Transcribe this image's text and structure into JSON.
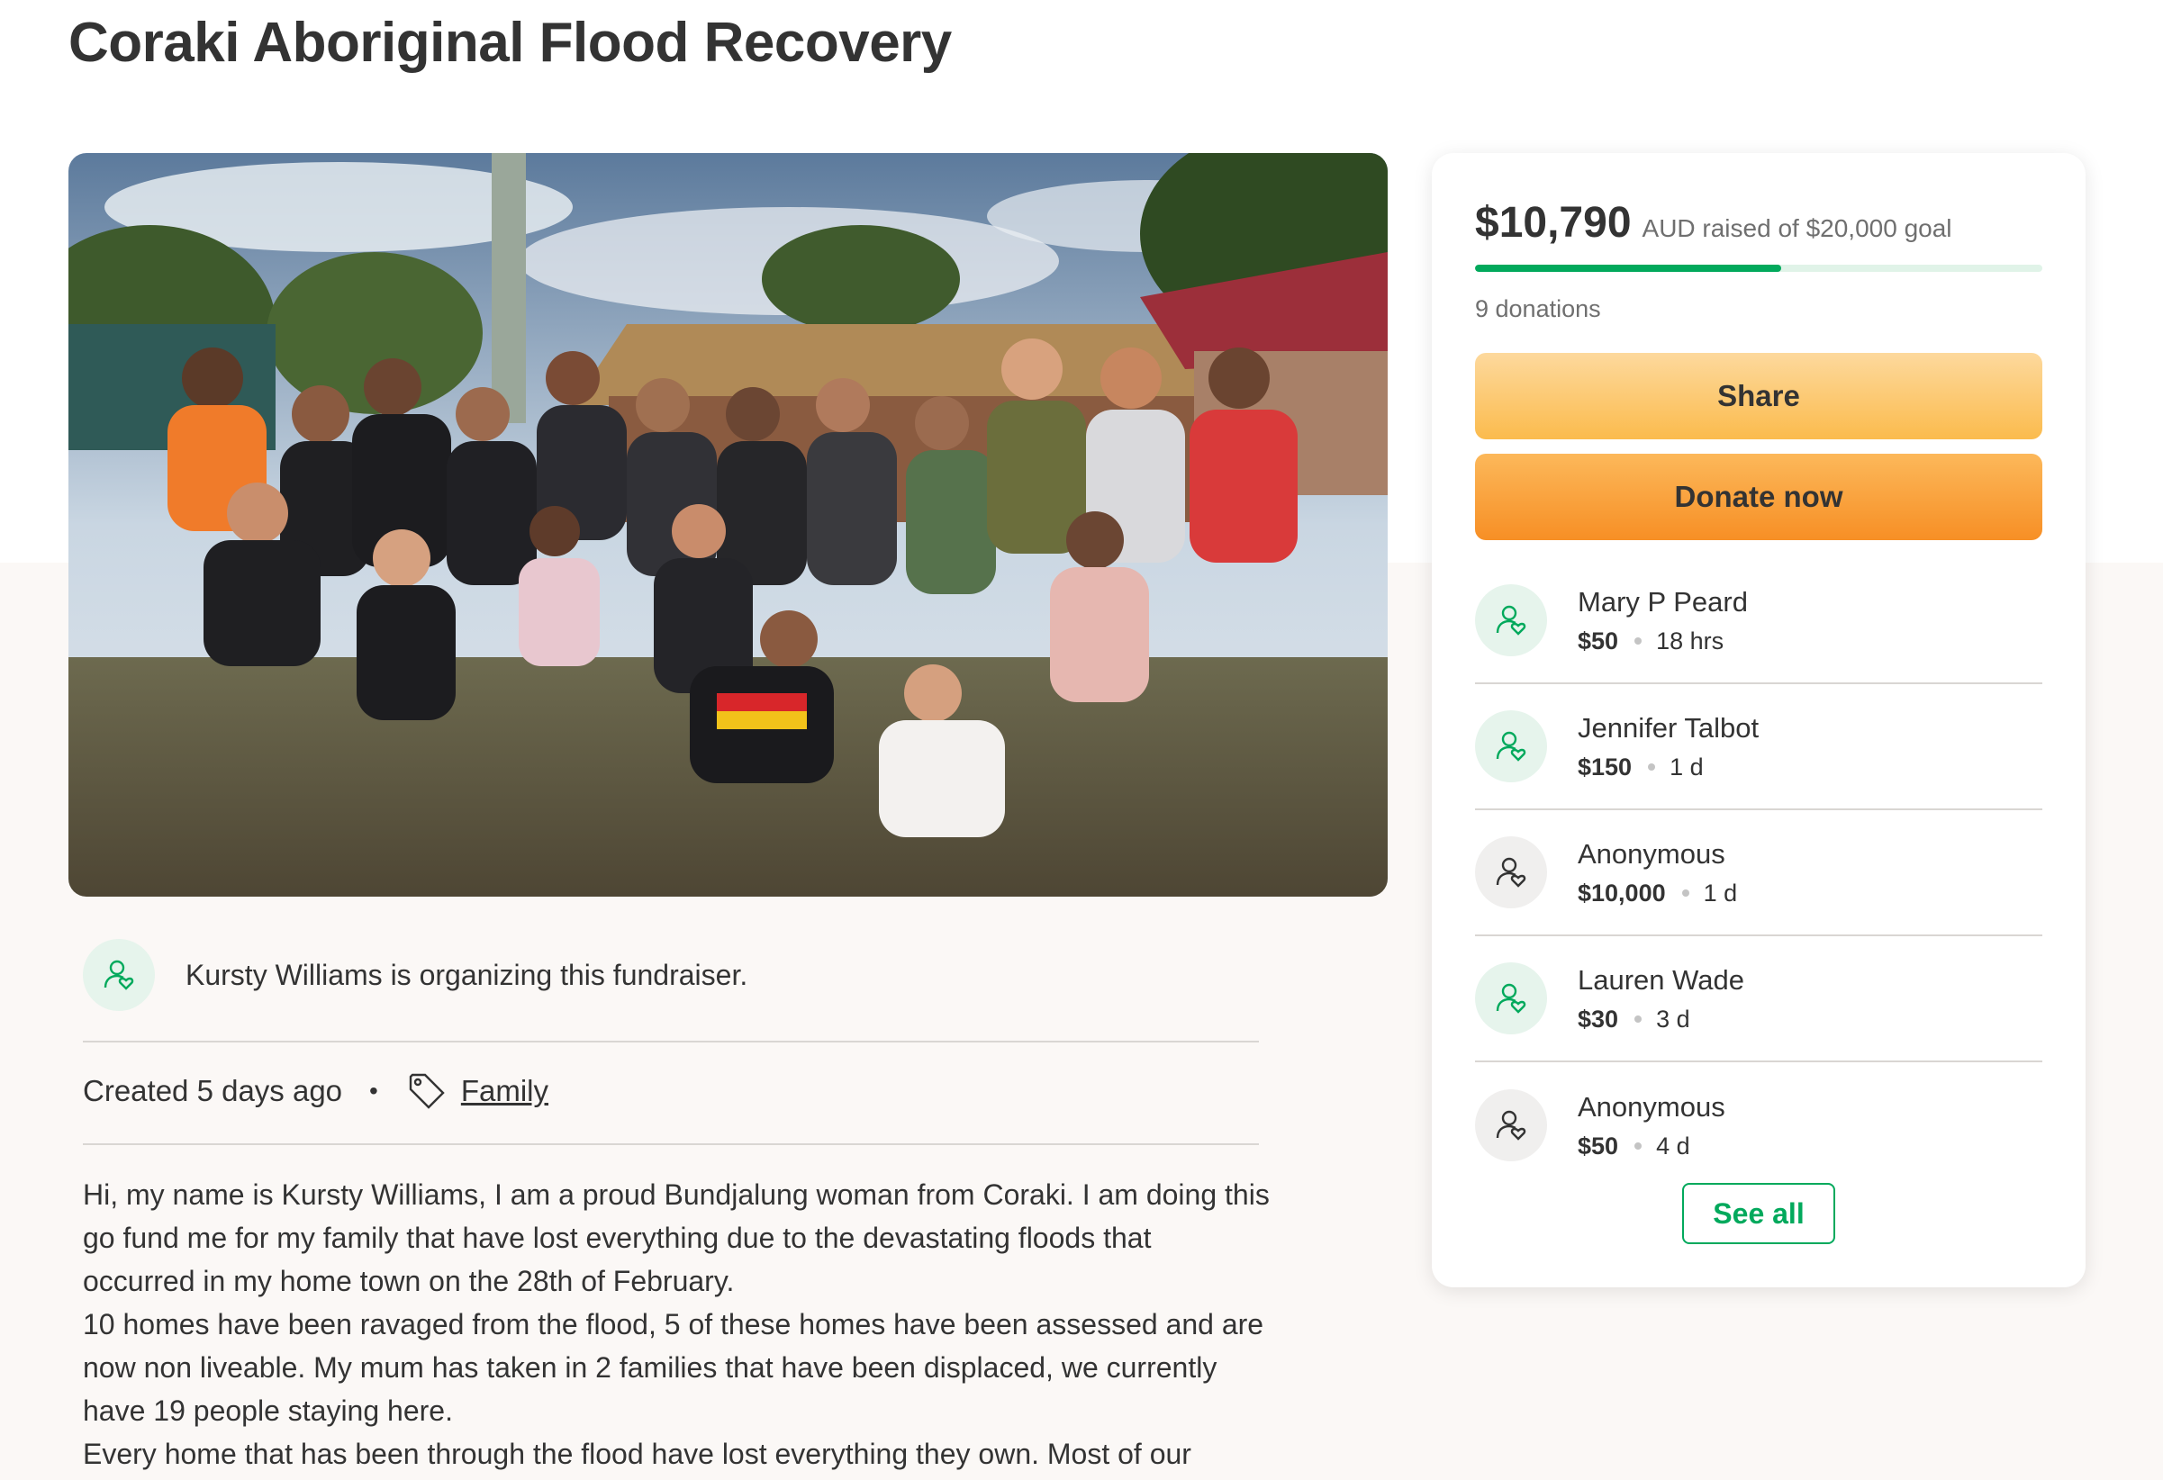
{
  "page": {
    "title": "Coraki Aboriginal Flood Recovery"
  },
  "organizer": {
    "text": "Kursty Williams is organizing this fundraiser."
  },
  "meta": {
    "created": "Created 5 days ago",
    "separator": "•",
    "category": "Family"
  },
  "story": {
    "lines": [
      "Hi, my name is Kursty Williams, I am a proud Bundjalung woman from Coraki. I am doing this",
      "go fund me for my family  that have lost everything due to the devastating floods that",
      "occurred in my home town on the 28th of February.",
      "10 homes have been ravaged from the flood, 5 of these homes have been assessed and are",
      "now non liveable. My mum has taken in 2 families that have been displaced, we currently",
      "have 19 people staying here.",
      "Every home that has been through the flood have lost everything they own. Most of our"
    ]
  },
  "donation_card": {
    "amount": "$10,790",
    "raised_text": "AUD raised of $20,000 goal",
    "progress": 0.54,
    "donations_count": "9 donations",
    "share_label": "Share",
    "donate_label": "Donate now",
    "see_all_label": "See all",
    "donors": [
      {
        "name": "Mary P Peard",
        "amount": "$50",
        "time": "18 hrs",
        "avatar": "green"
      },
      {
        "name": "Jennifer Talbot",
        "amount": "$150",
        "time": "1 d",
        "avatar": "green"
      },
      {
        "name": "Anonymous",
        "amount": "$10,000",
        "time": "1 d",
        "avatar": "grey"
      },
      {
        "name": "Lauren Wade",
        "amount": "$30",
        "time": "3 d",
        "avatar": "green"
      },
      {
        "name": "Anonymous",
        "amount": "$50",
        "time": "4 d",
        "avatar": "grey"
      }
    ]
  },
  "colors": {
    "accent": "#02a95c",
    "share_button": "#fbc76b",
    "donate_button": "#f9a13c",
    "text": "#333333"
  },
  "icons": {
    "avatar": "user-heart-icon",
    "category": "tag-icon"
  }
}
